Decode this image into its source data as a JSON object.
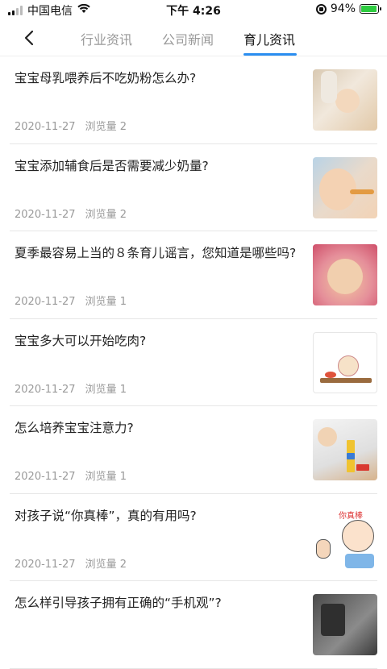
{
  "status_bar": {
    "carrier": "中国电信",
    "time": "下午 4:26",
    "battery_percent": "94%",
    "battery_level": 0.94
  },
  "nav": {
    "tabs": [
      {
        "label": "行业资讯",
        "active": false
      },
      {
        "label": "公司新闻",
        "active": false
      },
      {
        "label": "育儿资讯",
        "active": true
      }
    ]
  },
  "articles": [
    {
      "title": "宝宝母乳喂养后不吃奶粉怎么办?",
      "date": "2020-11-27",
      "views": "浏览量 2"
    },
    {
      "title": "宝宝添加辅食后是否需要减少奶量?",
      "date": "2020-11-27",
      "views": "浏览量 2"
    },
    {
      "title": "夏季最容易上当的８条育儿谣言，您知道是哪些吗?",
      "date": "2020-11-27",
      "views": "浏览量 1"
    },
    {
      "title": "宝宝多大可以开始吃肉?",
      "date": "2020-11-27",
      "views": "浏览量 1"
    },
    {
      "title": "怎么培养宝宝注意力?",
      "date": "2020-11-27",
      "views": "浏览量 1"
    },
    {
      "title": "对孩子说“你真棒”，真的有用吗?",
      "date": "2020-11-27",
      "views": "浏览量 2",
      "thumb_caption": "你真棒"
    },
    {
      "title": "怎么样引导孩子拥有正确的“手机观”?",
      "date": "",
      "views": ""
    }
  ],
  "colors": {
    "accent": "#2a8ef0",
    "active_tab_text": "#111111",
    "inactive_tab_text": "#999999",
    "meta_text": "#9a9a9a"
  }
}
